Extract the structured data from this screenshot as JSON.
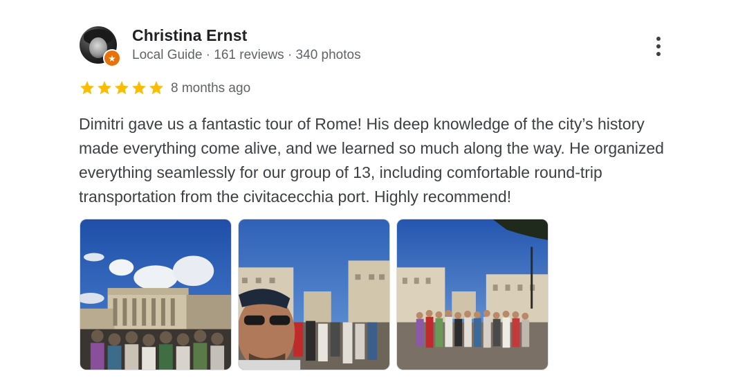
{
  "reviewer": {
    "name": "Christina Ernst",
    "meta": "Local Guide · 161 reviews · 340 photos",
    "avatar_icon": "profile-photo",
    "badge_icon": "local-guide-star-icon",
    "badge_color": "#e8710a"
  },
  "rating": {
    "stars": 5,
    "max_stars": 5,
    "star_color": "#fbbc04",
    "date": "8 months ago"
  },
  "review_text": "Dimitri gave us a fantastic tour of Rome! His deep knowledge of the city’s history made everything come alive, and we learned so much along the way. He organized everything seamlessly for our group of 13, including comfortable round-trip transportation from the civitacecchia port. Highly recommend!",
  "menu_icon": "more-vert-icon",
  "photos": [
    {
      "subject": "group-at-st-peters-basilica"
    },
    {
      "subject": "selfie-with-group-via-della-conciliazione"
    },
    {
      "subject": "group-photo-via-della-conciliazione"
    }
  ]
}
